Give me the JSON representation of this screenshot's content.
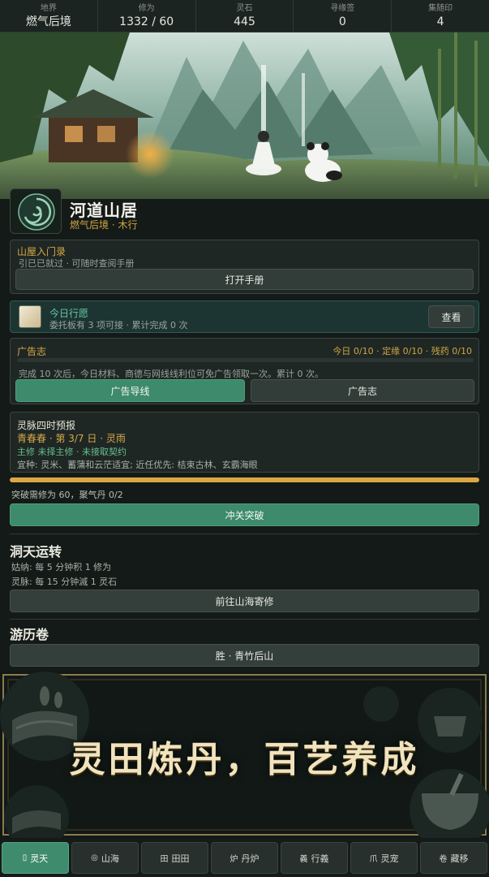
{
  "stats": [
    {
      "label": "地界",
      "value": "燃气后境"
    },
    {
      "label": "修为",
      "value": "1332 / 60"
    },
    {
      "label": "灵石",
      "value": "445"
    },
    {
      "label": "寻缘签",
      "value": "0"
    },
    {
      "label": "集随印",
      "value": "4"
    }
  ],
  "location": {
    "title": "河道山居",
    "subtitle": "燃气后境 · 木行"
  },
  "guide": {
    "title": "山屋入门录",
    "desc": "引已已就过 · 可随时查阅手册",
    "button": "打开手册"
  },
  "vow": {
    "title": "今日行愿",
    "desc": "委托板有 3 项可接 · 累计完成 0 次",
    "button": "查看"
  },
  "ads": {
    "title": "广告志",
    "progress": "今日 0/10 · 定缘 0/10 · 残药 0/10",
    "desc": "完成 10 次后，今日材料、商德与网线线利位可免广告领取一次。累计 0 次。",
    "button_primary": "广告导线",
    "button_secondary": "广告志"
  },
  "forecast": {
    "title": "灵脉四时预报",
    "season": "青春春 · 第 3/7 日 · 灵雨",
    "line1": "主修 未择主修 · 未接取契约",
    "line2": "宜种: 灵米、蓄蒲和云茫适宜; 近任优先: 桔束古林、玄霸海眼"
  },
  "breakthrough": {
    "progress_fraction": 1.0,
    "text": "突破需修为 60，聚气丹 0/2",
    "button": "冲关突破"
  },
  "cave": {
    "title": "洞天运转",
    "line1": "姑纳: 每 5 分钟积 1 修为",
    "line2": "灵脉: 每 15 分钟滅 1 灵石",
    "button": "前往山海寄修"
  },
  "travel": {
    "title": "游历卷",
    "button": "胜 · 青竹后山"
  },
  "promo": {
    "text": "灵田炼丹，百艺养成"
  },
  "nav": [
    {
      "icon": "▯",
      "label": "灵天"
    },
    {
      "icon": "◎",
      "label": "山海"
    },
    {
      "icon": "田",
      "label": "田田"
    },
    {
      "icon": "炉",
      "label": "丹炉"
    },
    {
      "icon": "義",
      "label": "行義"
    },
    {
      "icon": "爪",
      "label": "灵宠"
    },
    {
      "icon": "卷",
      "label": "藏移"
    }
  ],
  "colors": {
    "accent_green": "#3d8a6c",
    "gold": "#d7a84a",
    "teal_text": "#63c7a3",
    "bg": "#141a17"
  }
}
